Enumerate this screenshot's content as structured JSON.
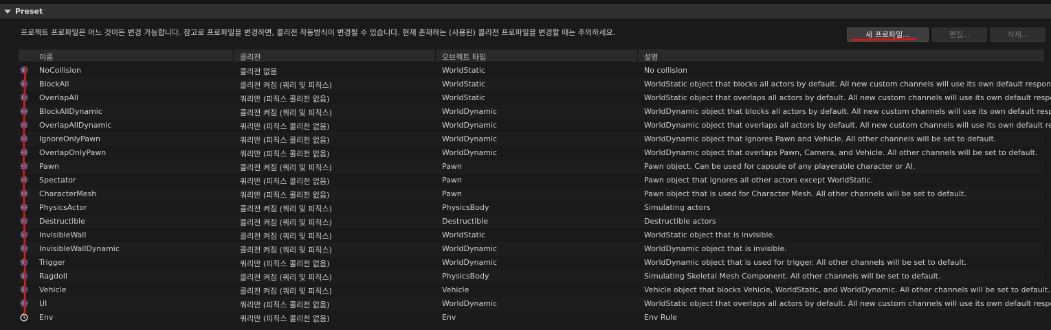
{
  "section": {
    "title": "Preset"
  },
  "description": "프로젝트 프로파일은 어느 것이든 변경 가능합니다. 참고로 프로파일을 변경하면, 콜리전 작동방식이 변경될 수 있습니다. 현재 존재하는 (사용된) 콜리전 프로파일을 변경할 때는 주의하세요.",
  "buttons": {
    "new_profile": "새 프로파일...",
    "edit": "편집...",
    "delete": "삭제..."
  },
  "columns": {
    "name": "이름",
    "collision": "콜리전",
    "object_type": "오브젝트 타입",
    "description": "설명"
  },
  "rows": [
    {
      "name": "NoCollision",
      "collision": "콜리전 없음",
      "object_type": "WorldStatic",
      "description": "No collision",
      "icon": "gear-icon"
    },
    {
      "name": "BlockAll",
      "collision": "콜리전 켜짐 (쿼리 및 피직스)",
      "object_type": "WorldStatic",
      "description": "WorldStatic object that blocks all actors by default. All new custom channels will use its own default response.",
      "icon": "gear-icon"
    },
    {
      "name": "OverlapAll",
      "collision": "쿼리만 (피직스 콜리전 없음)",
      "object_type": "WorldStatic",
      "description": "WorldStatic object that overlaps all actors by default. All new custom channels will use its own default response.",
      "icon": "gear-icon"
    },
    {
      "name": "BlockAllDynamic",
      "collision": "콜리전 켜짐 (쿼리 및 피직스)",
      "object_type": "WorldDynamic",
      "description": "WorldDynamic object that blocks all actors by default. All new custom channels will use its own default response.",
      "icon": "gear-icon"
    },
    {
      "name": "OverlapAllDynamic",
      "collision": "쿼리만 (피직스 콜리전 없음)",
      "object_type": "WorldDynamic",
      "description": "WorldDynamic object that overlaps all actors by default. All new custom channels will use its own default response.",
      "icon": "gear-icon"
    },
    {
      "name": "IgnoreOnlyPawn",
      "collision": "쿼리만 (피직스 콜리전 없음)",
      "object_type": "WorldDynamic",
      "description": "WorldDynamic object that ignores Pawn and Vehicle. All other channels will be set to default.",
      "icon": "gear-icon"
    },
    {
      "name": "OverlapOnlyPawn",
      "collision": "쿼리만 (피직스 콜리전 없음)",
      "object_type": "WorldDynamic",
      "description": "WorldDynamic object that overlaps Pawn, Camera, and Vehicle. All other channels will be set to default.",
      "icon": "gear-icon"
    },
    {
      "name": "Pawn",
      "collision": "콜리전 켜짐 (쿼리 및 피직스)",
      "object_type": "Pawn",
      "description": "Pawn object. Can be used for capsule of any playerable character or AI.",
      "icon": "gear-icon"
    },
    {
      "name": "Spectator",
      "collision": "쿼리만 (피직스 콜리전 없음)",
      "object_type": "Pawn",
      "description": "Pawn object that ignores all other actors except WorldStatic.",
      "icon": "gear-icon"
    },
    {
      "name": "CharacterMesh",
      "collision": "쿼리만 (피직스 콜리전 없음)",
      "object_type": "Pawn",
      "description": "Pawn object that is used for Character Mesh. All other channels will be set to default.",
      "icon": "gear-icon"
    },
    {
      "name": "PhysicsActor",
      "collision": "콜리전 켜짐 (쿼리 및 피직스)",
      "object_type": "PhysicsBody",
      "description": "Simulating actors",
      "icon": "gear-icon"
    },
    {
      "name": "Destructible",
      "collision": "콜리전 켜짐 (쿼리 및 피직스)",
      "object_type": "Destructible",
      "description": "Destructible actors",
      "icon": "gear-icon"
    },
    {
      "name": "InvisibleWall",
      "collision": "콜리전 켜짐 (쿼리 및 피직스)",
      "object_type": "WorldStatic",
      "description": "WorldStatic object that is invisible.",
      "icon": "gear-icon"
    },
    {
      "name": "InvisibleWallDynamic",
      "collision": "콜리전 켜짐 (쿼리 및 피직스)",
      "object_type": "WorldDynamic",
      "description": "WorldDynamic object that is invisible.",
      "icon": "gear-icon"
    },
    {
      "name": "Trigger",
      "collision": "쿼리만 (피직스 콜리전 없음)",
      "object_type": "WorldDynamic",
      "description": "WorldDynamic object that is used for trigger. All other channels will be set to default.",
      "icon": "gear-icon"
    },
    {
      "name": "Ragdoll",
      "collision": "콜리전 켜짐 (쿼리 및 피직스)",
      "object_type": "PhysicsBody",
      "description": "Simulating Skeletal Mesh Component. All other channels will be set to default.",
      "icon": "gear-icon"
    },
    {
      "name": "Vehicle",
      "collision": "콜리전 켜짐 (쿼리 및 피직스)",
      "object_type": "Vehicle",
      "description": "Vehicle object that blocks Vehicle, WorldStatic, and WorldDynamic. All other channels will be set to default.",
      "icon": "gear-icon"
    },
    {
      "name": "UI",
      "collision": "쿼리만 (피직스 콜리전 없음)",
      "object_type": "WorldDynamic",
      "description": "WorldStatic object that overlaps all actors by default. All new custom channels will use its own default response.",
      "icon": "gear-icon"
    },
    {
      "name": "Env",
      "collision": "쿼리만 (피직스 콜리전 없음)",
      "object_type": "Env",
      "description": "Env Rule",
      "icon": "stopwatch-icon"
    }
  ],
  "colors": {
    "annotation_red": "#d21a1a",
    "icon_blue": "#4a7bd0"
  }
}
